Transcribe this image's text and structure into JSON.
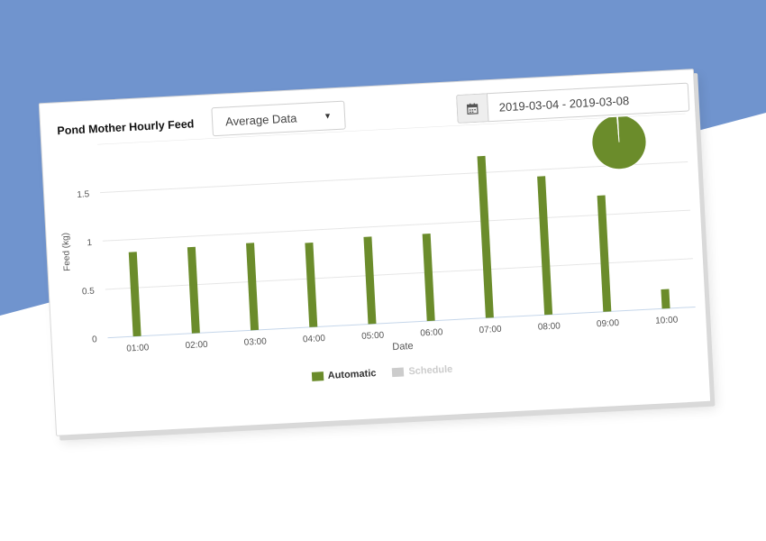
{
  "header": {
    "title": "Pond Mother Hourly Feed",
    "select_value": "Average Data",
    "date_range": "2019-03-04 - 2019-03-08"
  },
  "colors": {
    "background_blue": "#7094ce",
    "automatic": "#6b8c2b",
    "schedule": "#cccccc",
    "grid": "#e6e6e6",
    "axis_line": "#c5d6ea"
  },
  "icons": {
    "calendar": "calendar-icon",
    "caret": "caret-down-icon"
  },
  "chart_data": {
    "type": "bar",
    "xlabel": "Date",
    "ylabel": "Feed (kg)",
    "categories": [
      "01:00",
      "02:00",
      "03:00",
      "04:00",
      "05:00",
      "06:00",
      "07:00",
      "08:00",
      "09:00",
      "10:00"
    ],
    "ylim": [
      0,
      2
    ],
    "yticks": [
      0,
      0.5,
      1,
      1.5
    ],
    "ytick_labels": [
      "0",
      "0.5",
      "1",
      "1.5"
    ],
    "grid": true,
    "legend_position": "bottom-center",
    "series": [
      {
        "name": "Automatic",
        "color": "#6b8c2b",
        "values": [
          0.87,
          0.89,
          0.9,
          0.87,
          0.9,
          0.9,
          1.67,
          1.43,
          1.2,
          0.2
        ]
      },
      {
        "name": "Schedule",
        "color": "#cccccc",
        "values": []
      }
    ],
    "inset_pie": {
      "values": [
        99.5,
        0.5
      ],
      "colors": [
        "#6b8c2b",
        "#ffffff"
      ]
    }
  }
}
